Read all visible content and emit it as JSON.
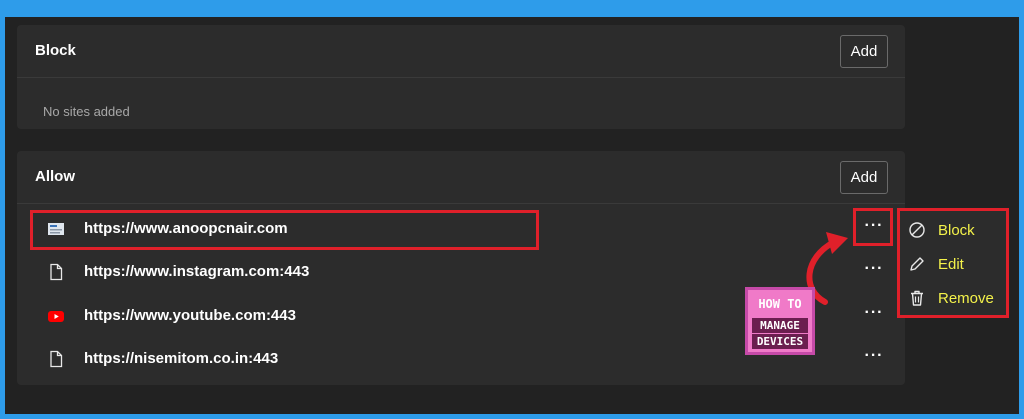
{
  "block_section": {
    "title": "Block",
    "add_label": "Add",
    "empty_text": "No sites added"
  },
  "allow_section": {
    "title": "Allow",
    "add_label": "Add",
    "sites": [
      {
        "url": "https://www.anoopcnair.com",
        "icon": "site-favicon-icon",
        "more": "···"
      },
      {
        "url": "https://www.instagram.com:443",
        "icon": "file-icon",
        "more": "···"
      },
      {
        "url": "https://www.youtube.com:443",
        "icon": "youtube-icon",
        "more": "···"
      },
      {
        "url": "https://nisemitom.co.in:443",
        "icon": "file-icon",
        "more": "···"
      }
    ]
  },
  "context_menu": {
    "items": [
      {
        "label": "Block",
        "icon": "block-icon"
      },
      {
        "label": "Edit",
        "icon": "pencil-icon"
      },
      {
        "label": "Remove",
        "icon": "trash-icon"
      }
    ]
  },
  "watermark": {
    "line1": "HOW TO",
    "line2": "MANAGE",
    "line3": "DEVICES"
  },
  "colors": {
    "highlight": "#e0202a",
    "menu_label": "#f4f24a",
    "frame": "#2e9cea"
  }
}
